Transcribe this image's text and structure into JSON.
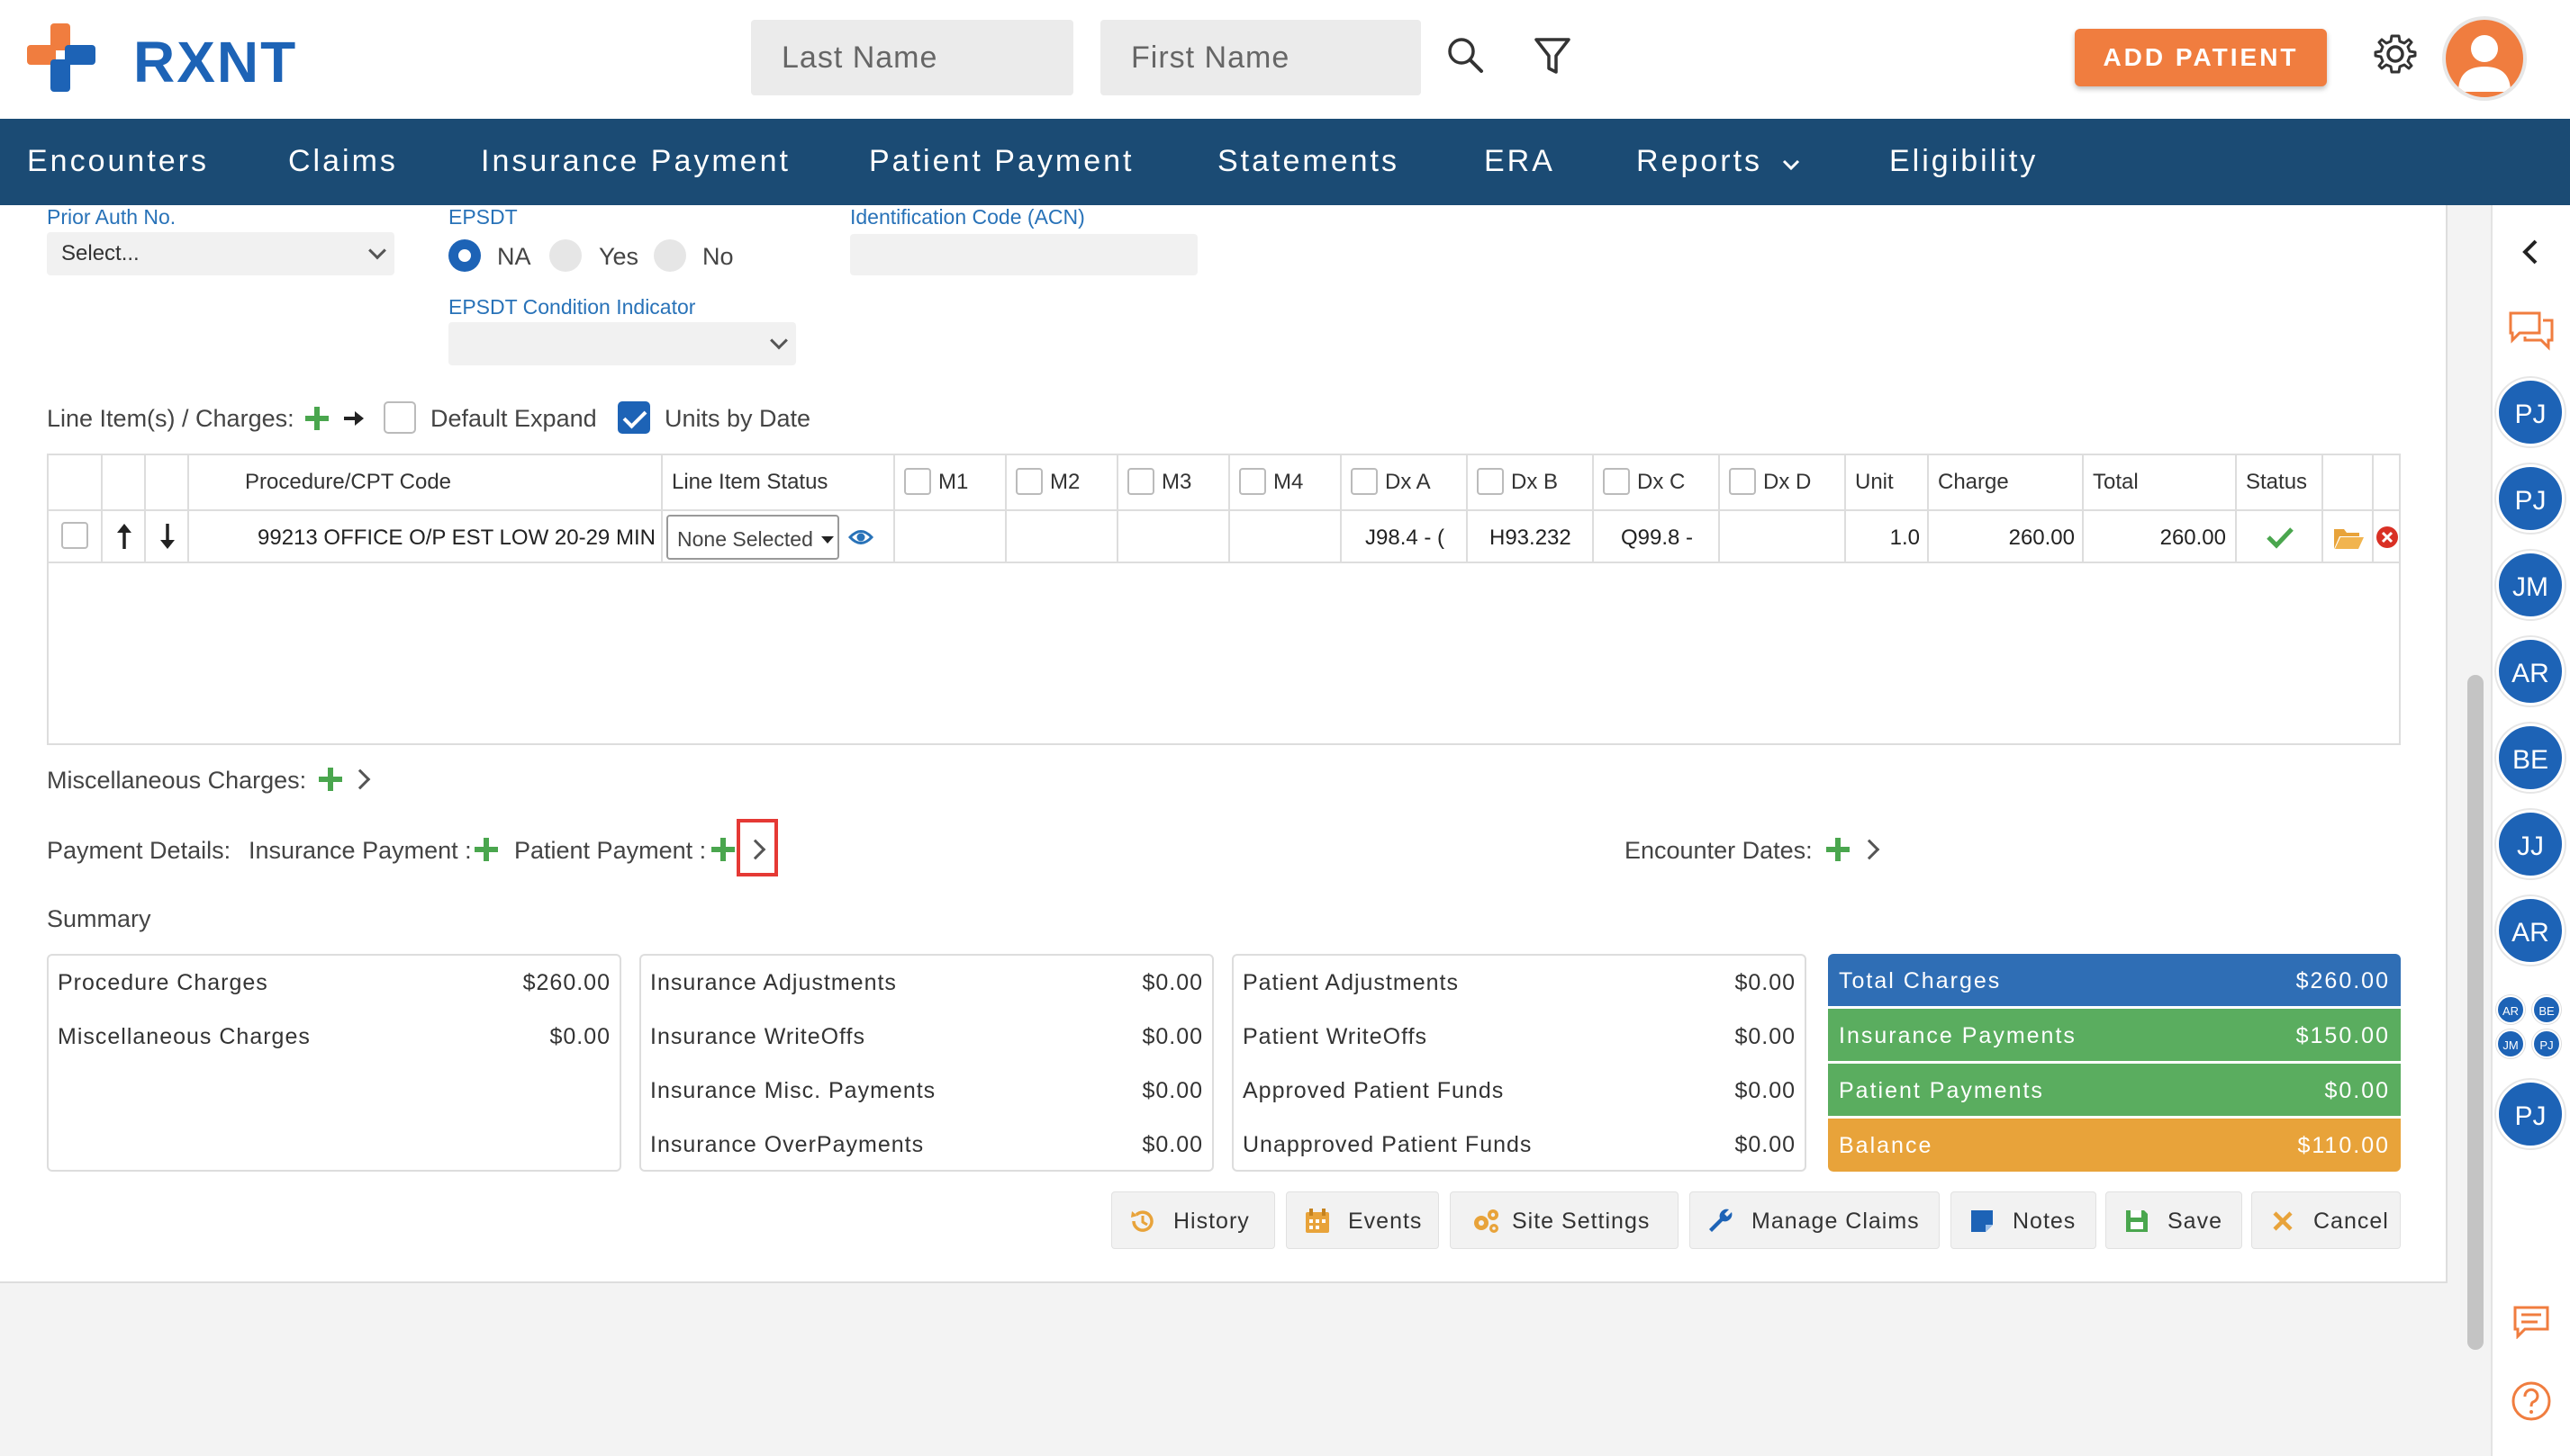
{
  "brand": {
    "name": "RXNT",
    "accent": "#1d63b6",
    "orange": "#f07d3f"
  },
  "search": {
    "last_name_placeholder": "Last Name",
    "first_name_placeholder": "First Name"
  },
  "header": {
    "add_patient_label": "ADD PATIENT"
  },
  "nav": {
    "items": [
      "Encounters",
      "Claims",
      "Insurance Payment",
      "Patient Payment",
      "Statements",
      "ERA",
      "Reports",
      "Eligibility"
    ]
  },
  "form": {
    "prior_auth_label": "Prior Auth No.",
    "prior_auth_value": "Select...",
    "epsdt_label": "EPSDT",
    "epsdt_options": [
      "NA",
      "Yes",
      "No"
    ],
    "epsdt_selected": "NA",
    "epsdt_condition_label": "EPSDT Condition Indicator",
    "acn_label": "Identification Code (ACN)"
  },
  "line_items": {
    "label": "Line Item(s) / Charges:",
    "default_expand_label": "Default Expand",
    "default_expand_checked": false,
    "units_by_date_label": "Units by Date",
    "units_by_date_checked": true,
    "columns": {
      "procedure": "Procedure/CPT Code",
      "status": "Line Item Status",
      "m1": "M1",
      "m2": "M2",
      "m3": "M3",
      "m4": "M4",
      "dxa": "Dx A",
      "dxb": "Dx B",
      "dxc": "Dx C",
      "dxd": "Dx D",
      "unit": "Unit",
      "charge": "Charge",
      "total": "Total",
      "row_status": "Status"
    },
    "rows": [
      {
        "procedure": "99213 OFFICE O/P EST LOW 20-29 MIN",
        "status": "None Selected",
        "dxa": "J98.4 - (",
        "dxb": "H93.232",
        "dxc": "Q99.8 -",
        "unit": "1.0",
        "charge": "260.00",
        "total": "260.00"
      }
    ]
  },
  "misc_charges_label": "Miscellaneous Charges:",
  "payment_details": {
    "label": "Payment Details:",
    "insurance_payment_label": "Insurance Payment :",
    "patient_payment_label": "Patient Payment :"
  },
  "encounter_dates_label": "Encounter Dates:",
  "summary": {
    "title": "Summary",
    "box1": [
      {
        "k": "Procedure Charges",
        "v": "$260.00"
      },
      {
        "k": "Miscellaneous Charges",
        "v": "$0.00"
      }
    ],
    "box2": [
      {
        "k": "Insurance Adjustments",
        "v": "$0.00"
      },
      {
        "k": "Insurance WriteOffs",
        "v": "$0.00"
      },
      {
        "k": "Insurance Misc. Payments",
        "v": "$0.00"
      },
      {
        "k": "Insurance OverPayments",
        "v": "$0.00"
      }
    ],
    "box3": [
      {
        "k": "Patient Adjustments",
        "v": "$0.00"
      },
      {
        "k": "Patient WriteOffs",
        "v": "$0.00"
      },
      {
        "k": "Approved Patient Funds",
        "v": "$0.00"
      },
      {
        "k": "Unapproved Patient Funds",
        "v": "$0.00"
      }
    ],
    "totals": [
      {
        "k": "Total Charges",
        "v": "$260.00",
        "color": "#2f6eb5"
      },
      {
        "k": "Insurance Payments",
        "v": "$150.00",
        "color": "#5aad5f"
      },
      {
        "k": "Patient Payments",
        "v": "$0.00",
        "color": "#5aad5f"
      },
      {
        "k": "Balance",
        "v": "$110.00",
        "color": "#e8a33a"
      }
    ]
  },
  "actions": {
    "history": "History",
    "events": "Events",
    "site_settings": "Site Settings",
    "manage_claims": "Manage Claims",
    "notes": "Notes",
    "save": "Save",
    "cancel": "Cancel"
  },
  "sidebar": {
    "users": [
      "PJ",
      "PJ",
      "JM",
      "AR",
      "BE",
      "JJ",
      "AR"
    ],
    "mini_users": [
      "AR",
      "BE",
      "JM",
      "PJ"
    ],
    "last_user": "PJ"
  }
}
